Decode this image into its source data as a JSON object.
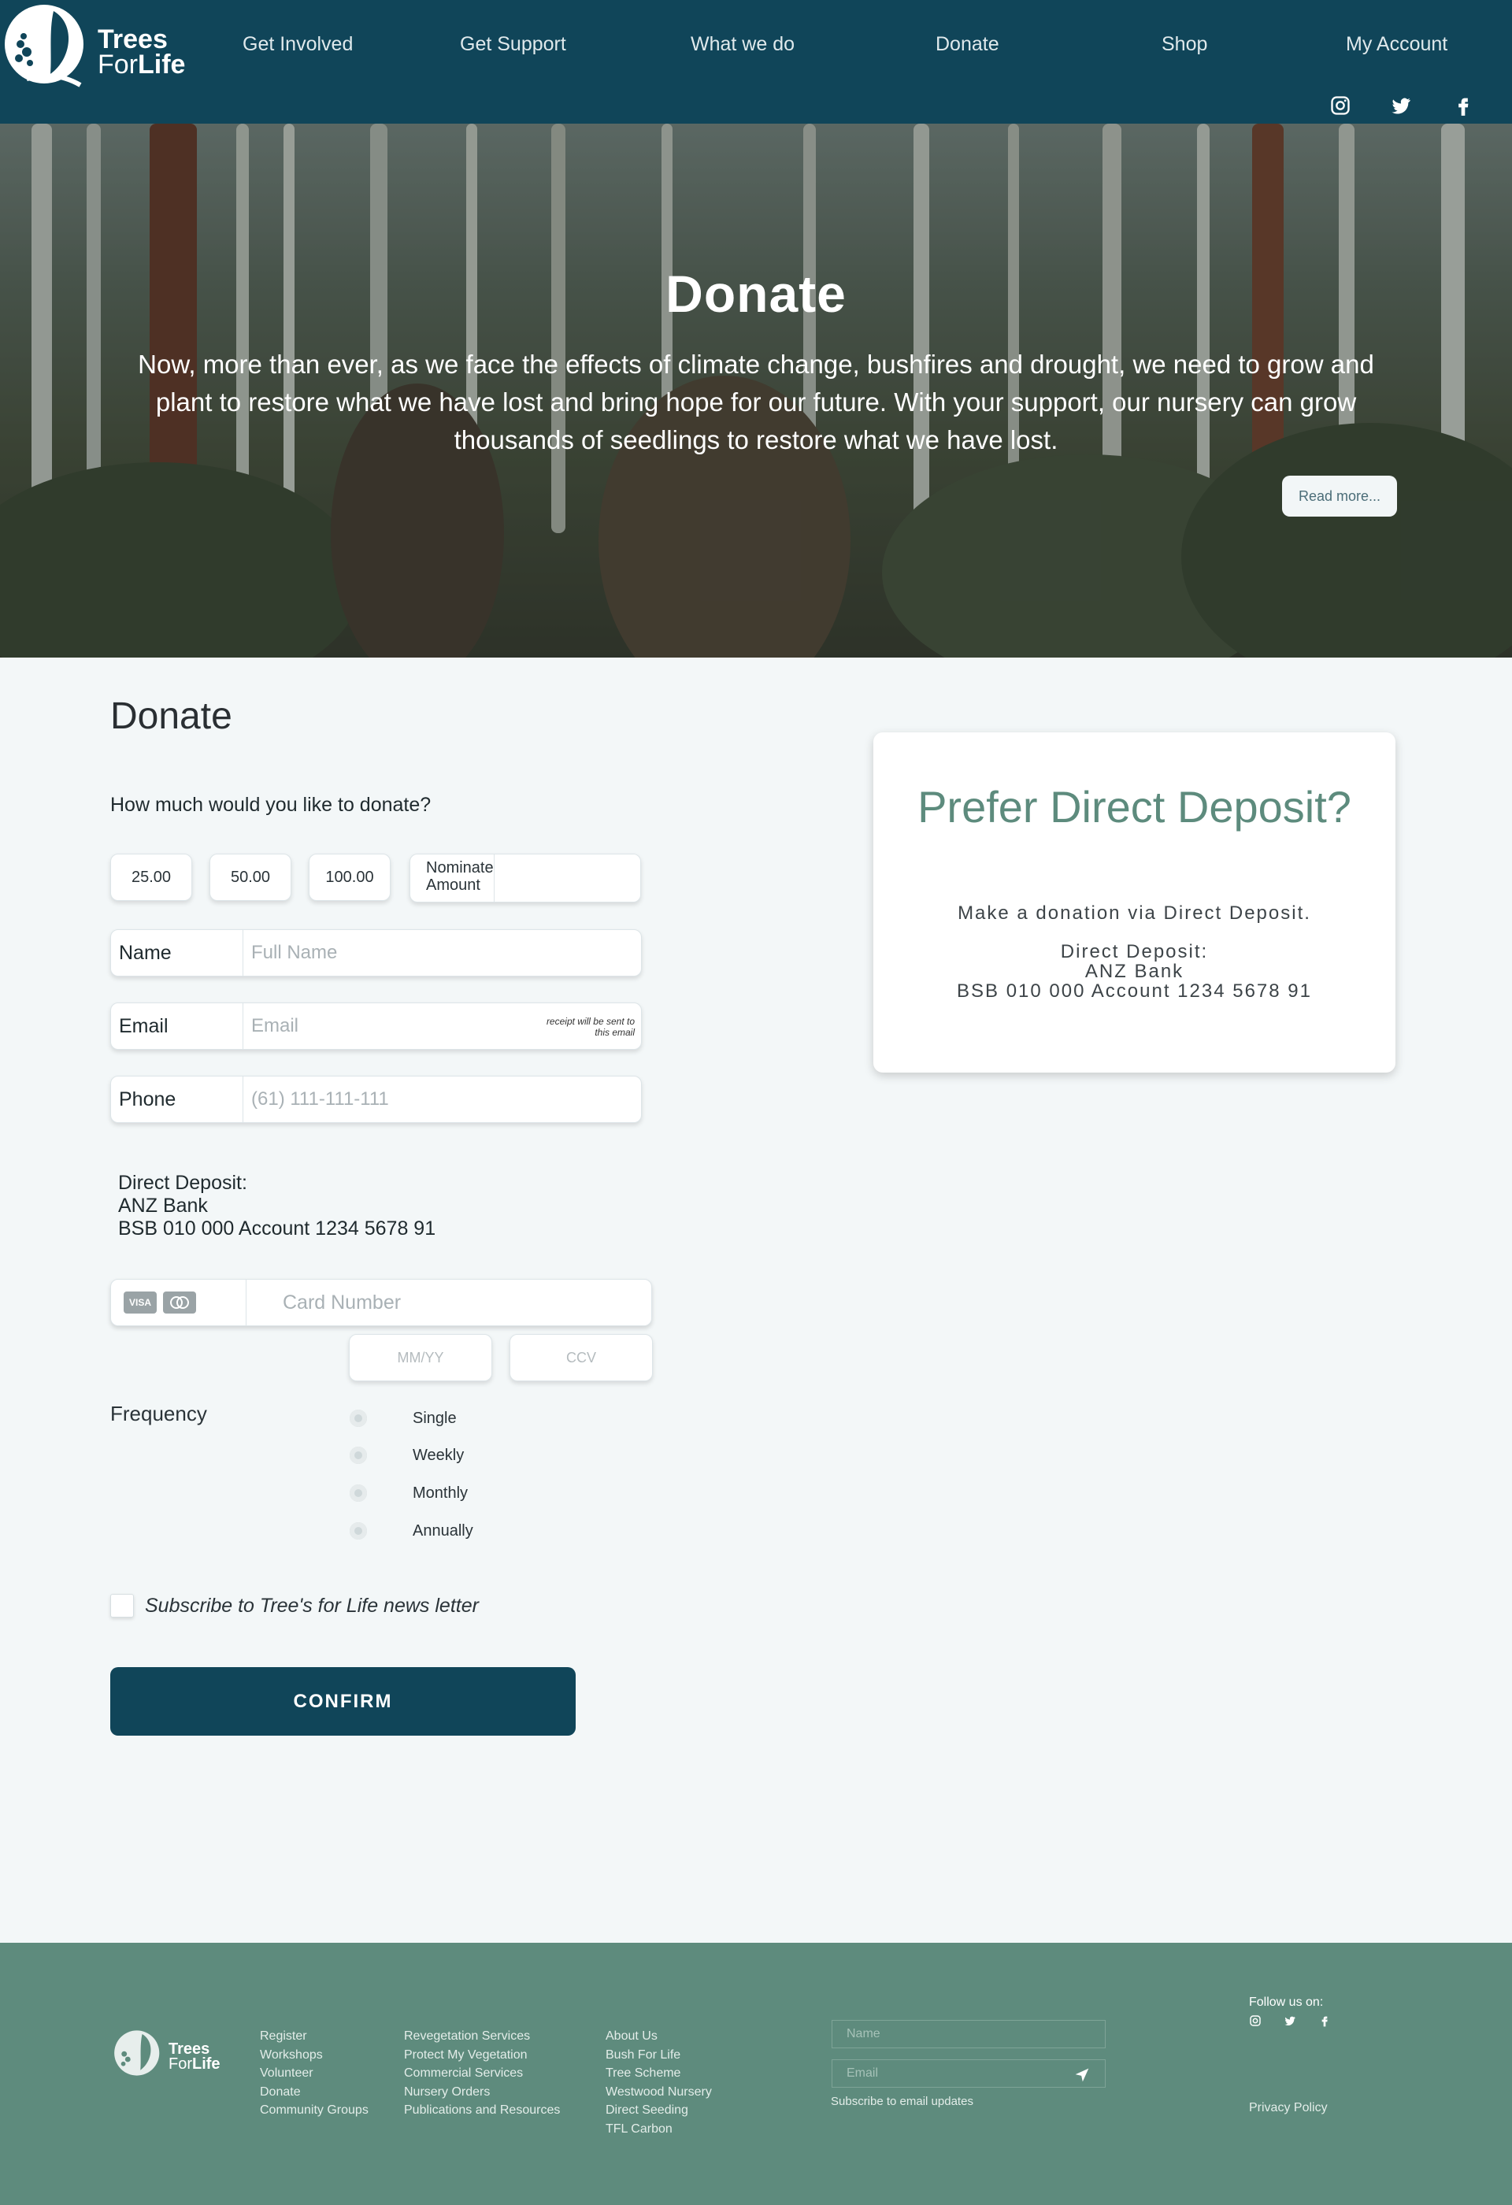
{
  "brand": {
    "line1": "Trees",
    "line2_prefix": "For",
    "line2_bold": "Life"
  },
  "nav": [
    "Get Involved",
    "Get Support",
    "What we do",
    "Donate",
    "Shop",
    "My Account"
  ],
  "social": [
    "instagram-icon",
    "twitter-icon",
    "facebook-icon"
  ],
  "hero": {
    "title": "Donate",
    "text": "Now, more than ever, as we face the effects of climate change, bushfires and drought, we need to grow and plant to restore what we have lost and bring hope for our future. With your support, our nursery can grow thousands of seedlings to restore what we have lost.",
    "read_more": "Read more..."
  },
  "form": {
    "title": "Donate",
    "question": "How much would you like to donate?",
    "amounts": [
      "25.00",
      "50.00",
      "100.00"
    ],
    "nominate_label": "Nominate Amount",
    "nominate_value": "",
    "name_label": "Name",
    "name_placeholder": "Full Name",
    "email_label": "Email",
    "email_placeholder": "Email",
    "email_note": "receipt will be sent to this email",
    "phone_label": "Phone",
    "phone_placeholder": "(61) 111-111-111",
    "deposit_lines": [
      "Direct Deposit:",
      "ANZ Bank",
      "BSB 010 000 Account 1234 5678 91"
    ],
    "card_brands": [
      "VISA",
      "MC"
    ],
    "card_placeholder": "Card Number",
    "expiry_placeholder": "MM/YY",
    "ccv_placeholder": "CCV",
    "frequency_label": "Frequency",
    "frequencies": [
      "Single",
      "Weekly",
      "Monthly",
      "Annually"
    ],
    "subscribe_label": "Subscribe to Tree's for Life news letter",
    "confirm": "CONFIRM"
  },
  "direct_deposit_card": {
    "title": "Prefer Direct Deposit?",
    "subtitle": "Make a donation via Direct Deposit.",
    "lines": [
      "Direct Deposit:",
      "ANZ Bank",
      "BSB 010 000 Account 1234 5678 91"
    ]
  },
  "footer": {
    "col1": [
      "Register",
      "Workshops",
      "Volunteer",
      "Donate",
      "Community Groups"
    ],
    "col2": [
      "Revegetation Services",
      "Protect My Vegetation",
      "Commercial Services",
      "Nursery Orders",
      "Publications and Resources"
    ],
    "col3": [
      "About Us",
      "Bush For Life",
      "Tree Scheme",
      "Westwood Nursery",
      "Direct Seeding",
      "TFL Carbon"
    ],
    "name_placeholder": "Name",
    "email_placeholder": "Email",
    "subscribe_text": "Subscribe to email updates",
    "follow": "Follow us on:",
    "privacy": "Privacy Policy"
  },
  "colors": {
    "primary": "#104559",
    "footer": "#5e8b7d",
    "accent_text": "#5d8b7d",
    "background": "#f3f7f8"
  }
}
